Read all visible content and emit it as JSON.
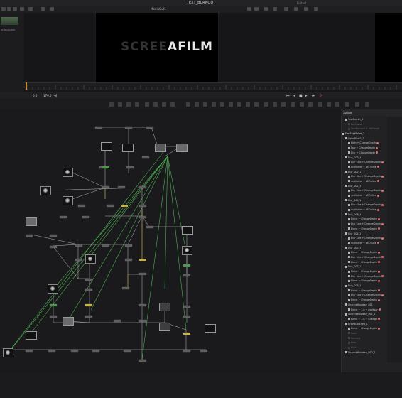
{
  "window": {
    "title": "TEXT_BURNOUT",
    "subtitle": "Edited"
  },
  "viewer": {
    "name": "MediaOut1",
    "logo_dim": "SCREE",
    "logo_bright": "AFILM"
  },
  "mediapool": {
    "clip_name": "01.00.00.000"
  },
  "transport": {
    "frame": "0.0",
    "end": "179.0"
  },
  "spline": {
    "title": "Spline",
    "items": [
      {
        "label": "TextBurnIn_1",
        "indent": 1,
        "check": true
      },
      {
        "label": "Keyframe",
        "indent": 2,
        "check": false
      },
      {
        "label": "TextBurnout + RNOmodi",
        "indent": 2,
        "check": false
      },
      {
        "label": "FastSoptShine_1",
        "indent": 0,
        "check": true
      },
      {
        "label": "ColorBlast1_1",
        "indent": 1,
        "check": true
      },
      {
        "label": "High + ChangeDepth",
        "indent": 2,
        "check": true,
        "dot": "#e07070"
      },
      {
        "label": "Low + ChangeDepth",
        "indent": 2,
        "check": true,
        "dot": "#e07070"
      },
      {
        "label": "Blur + ChangeDepth",
        "indent": 2,
        "check": true,
        "dot": "#e07070"
      },
      {
        "label": "Blur_003_1",
        "indent": 1,
        "check": true
      },
      {
        "label": "Blur Size + ChangeDepth",
        "indent": 2,
        "check": true,
        "dot": "#e07070"
      },
      {
        "label": "multiplier + NEOnline",
        "indent": 2,
        "check": true,
        "dot": "#e07070"
      },
      {
        "label": "Blur_002_1",
        "indent": 1,
        "check": true
      },
      {
        "label": "Blur Size + ChangeDepth",
        "indent": 2,
        "check": true,
        "dot": "#e07070"
      },
      {
        "label": "multiplier + NEOnline",
        "indent": 2,
        "check": true,
        "dot": "#e07070"
      },
      {
        "label": "Blur_001_1",
        "indent": 1,
        "check": true
      },
      {
        "label": "Blur Size + ChangeDepth",
        "indent": 2,
        "check": true,
        "dot": "#e07070"
      },
      {
        "label": "multiplier + NEOnline",
        "indent": 2,
        "check": true,
        "dot": "#e07070"
      },
      {
        "label": "Blur_000_1",
        "indent": 1,
        "check": true
      },
      {
        "label": "Blur Size + ChangeDepth",
        "indent": 2,
        "check": true,
        "dot": "#e07070"
      },
      {
        "label": "multiplier + NEOnline",
        "indent": 2,
        "check": true,
        "dot": "#e07070"
      },
      {
        "label": "Blur_006_1",
        "indent": 1,
        "check": true
      },
      {
        "label": "Blend + ChangeDepth",
        "indent": 2,
        "check": true,
        "dot": "#e07070"
      },
      {
        "label": "Blur Size + ChangeDepth",
        "indent": 2,
        "check": true,
        "dot": "#e07070"
      },
      {
        "label": "Blend + ChangeDepth",
        "indent": 2,
        "check": true,
        "dot": "#e07070"
      },
      {
        "label": "Blur_004_1",
        "indent": 1,
        "check": true
      },
      {
        "label": "Blur Size + ChangeDepth",
        "indent": 2,
        "check": true,
        "dot": "#e07070"
      },
      {
        "label": "multiplier + NEOnline",
        "indent": 2,
        "check": true,
        "dot": "#e07070"
      },
      {
        "label": "Blur_005_1",
        "indent": 1,
        "check": true
      },
      {
        "label": "Blend + ChangeDepth",
        "indent": 2,
        "check": true,
        "dot": "#e07070"
      },
      {
        "label": "Blur Size + ChangeDepth",
        "indent": 2,
        "check": true,
        "dot": "#e07070"
      },
      {
        "label": "Blend + ChangeDepth",
        "indent": 2,
        "check": true,
        "dot": "#e07070"
      },
      {
        "label": "Blur_007_1",
        "indent": 1,
        "check": true
      },
      {
        "label": "Blend + ChangeDepth",
        "indent": 2,
        "check": true,
        "dot": "#e07070"
      },
      {
        "label": "Blur Size + ChangeDepth",
        "indent": 2,
        "check": true,
        "dot": "#e07070"
      },
      {
        "label": "Blend + ChangeDepth",
        "indent": 2,
        "check": true,
        "dot": "#e07070"
      },
      {
        "label": "Blur_008_1",
        "indent": 1,
        "check": true
      },
      {
        "label": "Blend + ChangeDepth",
        "indent": 2,
        "check": true,
        "dot": "#e07070"
      },
      {
        "label": "Blur Size + ChangeDepth",
        "indent": 2,
        "check": true,
        "dot": "#e07070"
      },
      {
        "label": "Blend + ChangeDepth",
        "indent": 2,
        "check": true,
        "dot": "#e07070"
      },
      {
        "label": "ChannelBoolean_001",
        "indent": 1,
        "check": true
      },
      {
        "label": "Blend + 1.0 + multiply",
        "indent": 2,
        "check": true,
        "dot": "#e07070"
      },
      {
        "label": "ChannelBoolean_001_1",
        "indent": 1,
        "check": true
      },
      {
        "label": "Blend + 1.0 + Change",
        "indent": 2,
        "check": true,
        "dot": "#e07070"
      },
      {
        "label": "BrightContrast_1",
        "indent": 1,
        "check": true
      },
      {
        "label": "Blend + ChangeDepth",
        "indent": 2,
        "check": true,
        "dot": "#e07070"
      },
      {
        "label": "Gain",
        "indent": 2,
        "check": false
      },
      {
        "label": "Gamma",
        "indent": 2,
        "check": false
      },
      {
        "label": "Bias",
        "indent": 2,
        "check": false
      },
      {
        "label": "Alpha",
        "indent": 2,
        "check": false
      },
      {
        "label": "ChannelBoolean_002_1",
        "indent": 1,
        "check": true
      }
    ]
  },
  "colors": {
    "accent": "#d38b2c",
    "link_green": "#4caf50",
    "link_yellow": "#c8b44a",
    "node": "#5a5a5d",
    "dot": "#e07070"
  }
}
